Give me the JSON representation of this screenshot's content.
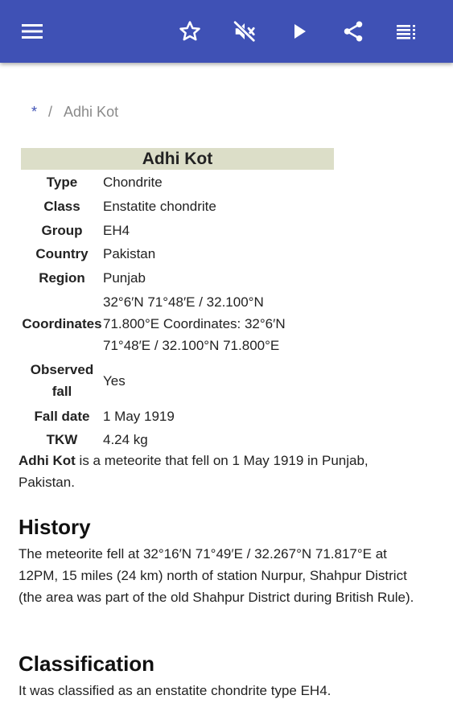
{
  "appbar": {
    "color": "#3f51b5",
    "icons": [
      "menu-icon",
      "star-icon",
      "volume-off-icon",
      "play-icon",
      "share-icon",
      "list-icon"
    ]
  },
  "breadcrumb": {
    "home": "*",
    "separator": "/",
    "current": "Adhi Kot"
  },
  "infobox": {
    "title": "Adhi Kot",
    "rows": [
      {
        "label": "Type",
        "value": "Chondrite"
      },
      {
        "label": "Class",
        "value": "Enstatite chondrite"
      },
      {
        "label": "Group",
        "value": "EH4"
      },
      {
        "label": "Country",
        "value": "Pakistan"
      },
      {
        "label": "Region",
        "value": "Punjab"
      },
      {
        "label": "Coordinates",
        "value_lines": [
          "32°6′N 71°48′E / 32.100°N",
          "71.800°E Coordinates: 32°6′N",
          "71°48′E / 32.100°N 71.800°E"
        ]
      },
      {
        "label_lines": [
          "Observed",
          "fall"
        ],
        "value": "Yes"
      },
      {
        "label": "Fall date",
        "value": "1 May 1919"
      },
      {
        "label": "TKW",
        "value": "4.24 kg"
      }
    ]
  },
  "intro": {
    "bold": "Adhi Kot",
    "text": " is a meteorite that fell on 1 May 1919 in Punjab, Pakistan."
  },
  "history": {
    "heading": "History",
    "text": "The meteorite fell at 32°16′N 71°49′E / 32.267°N 71.817°E at 12PM, 15 miles (24 km) north of station Nurpur, Shahpur District (the area was part of the old Shahpur District during British Rule)."
  },
  "classification": {
    "heading": "Classification",
    "text": "It was classified as an enstatite chondrite type EH4."
  }
}
